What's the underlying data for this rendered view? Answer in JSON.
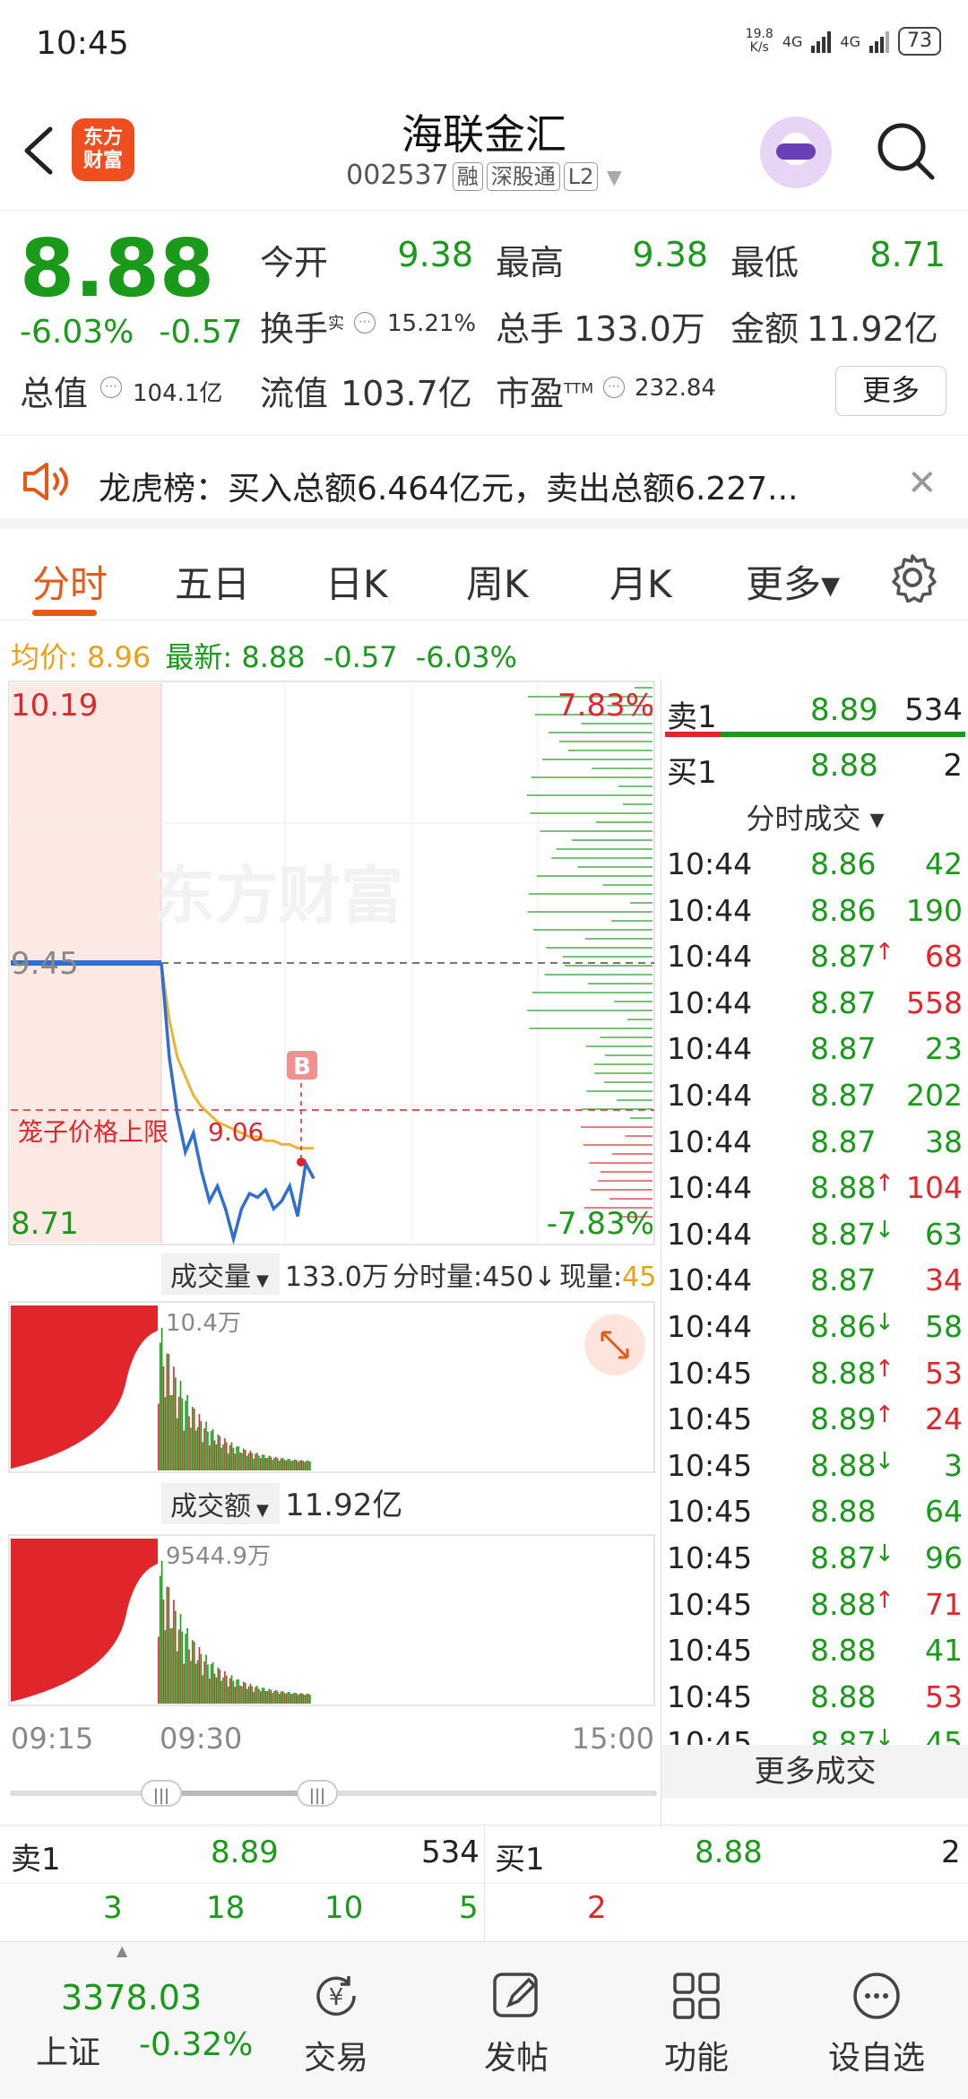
{
  "status_bar": {
    "time": "10:45",
    "speed_top": "19.8",
    "speed_bottom": "K/s",
    "net1": "4G",
    "net2": "4G",
    "battery": "73"
  },
  "header": {
    "logo_line1": "东方",
    "logo_line2": "财富",
    "name": "海联金汇",
    "code": "002537",
    "tags": [
      "融",
      "深股通",
      "L2"
    ]
  },
  "quote": {
    "price": "8.88",
    "change_pct": "-6.03%",
    "change": "-0.57",
    "open_label": "今开",
    "open": "9.38",
    "high_label": "最高",
    "high": "9.38",
    "low_label": "最低",
    "low": "8.71",
    "turnover_label": "换手",
    "turnover_sup": "实",
    "turnover": "15.21%",
    "volume_label": "总手",
    "volume": "133.0万",
    "amount_label": "金额",
    "amount": "11.92亿",
    "mcap_label": "总值",
    "mcap": "104.1亿",
    "float_label": "流值",
    "float": "103.7亿",
    "pe_label": "市盈",
    "pe_sup": "TTM",
    "pe": "232.84",
    "more": "更多"
  },
  "notice": {
    "text": "龙虎榜：买入总额6.464亿元，卖出总额6.227..."
  },
  "tabs": [
    "分时",
    "五日",
    "日K",
    "周K",
    "月K",
    "更多▾"
  ],
  "avg_line": {
    "avg_label": "均价:",
    "avg": "8.96",
    "last_label": "最新:",
    "last": "8.88",
    "chg": "-0.57",
    "pct": "-6.03%"
  },
  "chart": {
    "y_top": "10.19",
    "y_mid": "9.45",
    "y_bottom": "8.71",
    "pct_top": "7.83%",
    "pct_bottom": "-7.83%",
    "cage_label": "笼子价格上限",
    "cage_value": "9.06",
    "marker": "B",
    "watermark": "东方财富",
    "vol_label": "成交量",
    "vol_total": "133.0万",
    "vol_bucket": "分时量:450↓",
    "vol_now_label": "现量:",
    "vol_now": "45",
    "vol_max": "10.4万",
    "amt_label": "成交额",
    "amt_total": "11.92亿",
    "amt_max": "9544.9万",
    "x_start": "09:15",
    "x_open": "09:30",
    "x_end": "15:00"
  },
  "chart_data": {
    "type": "line",
    "title": "",
    "x": [
      "09:30",
      "09:31",
      "09:32",
      "09:33",
      "09:35",
      "09:38",
      "09:40",
      "09:45",
      "09:50",
      "09:55",
      "10:00",
      "10:05",
      "10:10",
      "10:15",
      "10:20",
      "10:25",
      "10:30",
      "10:35",
      "10:40",
      "10:45"
    ],
    "series": [
      {
        "name": "最新",
        "values": [
          9.45,
          9.2,
          9.05,
          8.95,
          9.0,
          8.9,
          8.82,
          8.86,
          8.8,
          8.72,
          8.8,
          8.84,
          8.83,
          8.85,
          8.8,
          8.82,
          8.86,
          8.78,
          8.92,
          8.88
        ]
      },
      {
        "name": "均价",
        "values": [
          9.45,
          9.3,
          9.2,
          9.15,
          9.1,
          9.07,
          9.05,
          9.03,
          9.02,
          9.01,
          9.0,
          8.99,
          8.99,
          8.98,
          8.98,
          8.97,
          8.97,
          8.96,
          8.96,
          8.96
        ]
      }
    ],
    "ylim": [
      8.71,
      10.19
    ],
    "prev_close": 9.45
  },
  "orderbook": {
    "sell1_label": "卖1",
    "sell1_price": "8.89",
    "sell1_vol": "534",
    "buy1_label": "买1",
    "buy1_price": "8.88",
    "buy1_vol": "2",
    "trades_header": "分时成交 ▾",
    "more_trades": "更多成交"
  },
  "trades": [
    {
      "time": "10:44",
      "price": "8.86",
      "arrow": "",
      "vol": "42",
      "color": "green"
    },
    {
      "time": "10:44",
      "price": "8.86",
      "arrow": "",
      "vol": "190",
      "color": "green"
    },
    {
      "time": "10:44",
      "price": "8.87",
      "arrow": "↑",
      "vol": "68",
      "color": "red"
    },
    {
      "time": "10:44",
      "price": "8.87",
      "arrow": "",
      "vol": "558",
      "color": "red"
    },
    {
      "time": "10:44",
      "price": "8.87",
      "arrow": "",
      "vol": "23",
      "color": "green"
    },
    {
      "time": "10:44",
      "price": "8.87",
      "arrow": "",
      "vol": "202",
      "color": "green"
    },
    {
      "time": "10:44",
      "price": "8.87",
      "arrow": "",
      "vol": "38",
      "color": "green"
    },
    {
      "time": "10:44",
      "price": "8.88",
      "arrow": "↑",
      "vol": "104",
      "color": "red"
    },
    {
      "time": "10:44",
      "price": "8.87",
      "arrow": "↓",
      "vol": "63",
      "color": "green"
    },
    {
      "time": "10:44",
      "price": "8.87",
      "arrow": "",
      "vol": "34",
      "color": "red"
    },
    {
      "time": "10:44",
      "price": "8.86",
      "arrow": "↓",
      "vol": "58",
      "color": "green"
    },
    {
      "time": "10:45",
      "price": "8.88",
      "arrow": "↑",
      "vol": "53",
      "color": "red"
    },
    {
      "time": "10:45",
      "price": "8.89",
      "arrow": "↑",
      "vol": "24",
      "color": "red"
    },
    {
      "time": "10:45",
      "price": "8.88",
      "arrow": "↓",
      "vol": "3",
      "color": "green"
    },
    {
      "time": "10:45",
      "price": "8.88",
      "arrow": "",
      "vol": "64",
      "color": "green"
    },
    {
      "time": "10:45",
      "price": "8.87",
      "arrow": "↓",
      "vol": "96",
      "color": "green"
    },
    {
      "time": "10:45",
      "price": "8.88",
      "arrow": "↑",
      "vol": "71",
      "color": "red"
    },
    {
      "time": "10:45",
      "price": "8.88",
      "arrow": "",
      "vol": "41",
      "color": "green"
    },
    {
      "time": "10:45",
      "price": "8.88",
      "arrow": "",
      "vol": "53",
      "color": "red"
    },
    {
      "time": "10:45",
      "price": "8.87",
      "arrow": "↓",
      "vol": "45",
      "color": "green"
    }
  ],
  "bottom_book": {
    "sell1_label": "卖1",
    "sell1_price": "8.89",
    "sell1_vol": "534",
    "buy1_label": "买1",
    "buy1_price": "8.88",
    "buy1_vol": "2",
    "sell_counts": [
      "3",
      "18",
      "10",
      "5"
    ],
    "buy_counts": [
      "2"
    ]
  },
  "nav": {
    "index_value": "3378.03",
    "index_name": "上证",
    "index_chg": "-0.32%",
    "items": [
      "交易",
      "发帖",
      "功能",
      "设自选"
    ]
  },
  "colors": {
    "up": "#e0262b",
    "down": "#1a9a1a",
    "accent": "#e55a17",
    "avg": "#e8a21a",
    "line": "#2f6fd1"
  }
}
